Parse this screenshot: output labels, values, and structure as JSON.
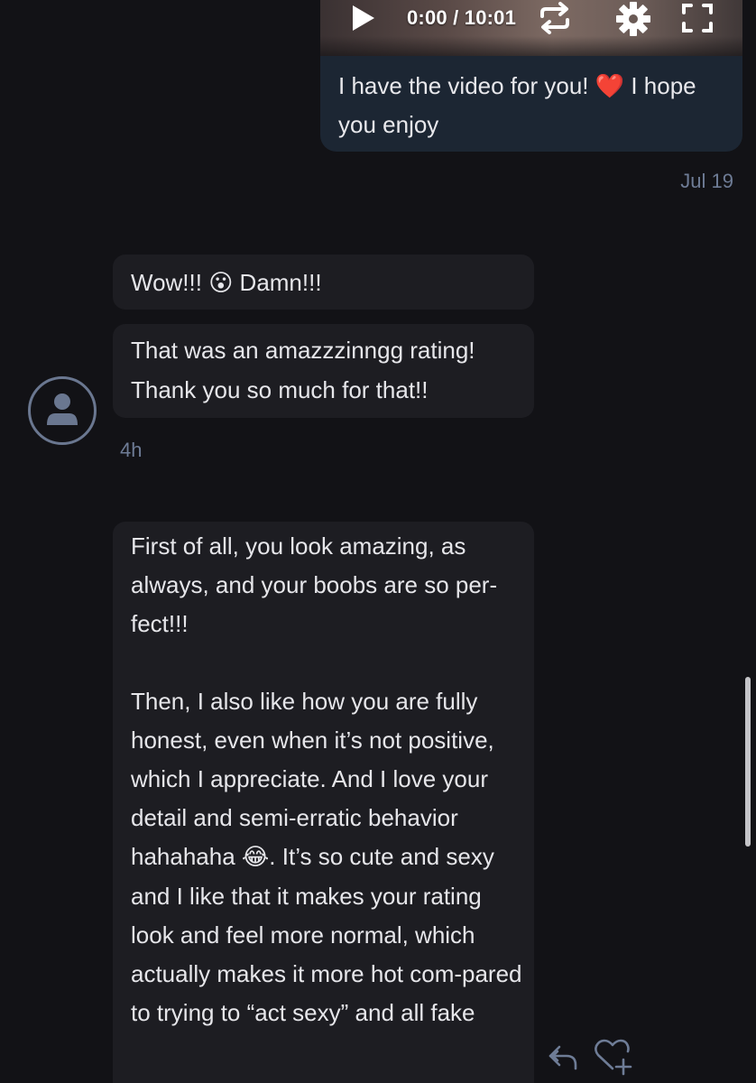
{
  "outgoing_message": {
    "video": {
      "time_display": "0:00 / 10:01"
    },
    "text_before_heart": "I have the video for you! ",
    "heart": "❤️",
    "text_after_heart": " I hope you enjoy"
  },
  "date_label": "Jul 19",
  "incoming_messages": [
    {
      "before": "Wow!!! ",
      "emoji": "😮",
      "after": " Damn!!!"
    },
    {
      "line1": "That was an amazzzinngg rating!",
      "line2": "Thank you so much for that!!"
    }
  ],
  "time_label": "4h",
  "long_message": {
    "para1": "First of all, you look amazing, as always, and your boobs are so per-fect!!!",
    "para2_before_emoji": "Then, I also like how you are fully honest, even when it’s not positive, which I appreciate. And I love your detail and semi-erratic behavior hahahaha ",
    "para2_emoji": "😂",
    "para2_after_emoji": ". It’s so cute and sexy and I like that it makes your rating look and feel more normal, which actually makes it more hot com-pared to trying to “act sexy” and all fake"
  },
  "colors": {
    "background": "#121216",
    "incoming_bubble": "#1d1d22",
    "outgoing_bubble": "#1c2633",
    "meta_text": "#6e7c96",
    "heart": "#e0343e"
  },
  "icons": {
    "video_controls": [
      "play-icon",
      "loop-icon",
      "gear-icon",
      "fullscreen-icon"
    ],
    "message_actions": [
      "reply-icon",
      "like-icon"
    ],
    "avatar": "user-avatar-icon"
  }
}
